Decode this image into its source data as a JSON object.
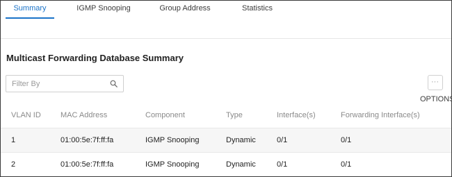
{
  "tabs": [
    {
      "label": "Summary",
      "active": true
    },
    {
      "label": "IGMP Snooping",
      "active": false
    },
    {
      "label": "Group Address",
      "active": false
    },
    {
      "label": "Statistics",
      "active": false
    }
  ],
  "accent_color": "#1a73c8",
  "page_title": "Multicast Forwarding Database Summary",
  "filter": {
    "placeholder": "Filter By",
    "value": "",
    "icon": "search-icon"
  },
  "options": {
    "label": "OPTIONS",
    "icon": "more-dots-icon"
  },
  "table": {
    "columns": [
      "VLAN ID",
      "MAC Address",
      "Component",
      "Type",
      "Interface(s)",
      "Forwarding Interface(s)"
    ],
    "rows": [
      [
        "1",
        "01:00:5e:7f:ff:fa",
        "IGMP Snooping",
        "Dynamic",
        "0/1",
        "0/1"
      ],
      [
        "2",
        "01:00:5e:7f:ff:fa",
        "IGMP Snooping",
        "Dynamic",
        "0/1",
        "0/1"
      ]
    ]
  }
}
